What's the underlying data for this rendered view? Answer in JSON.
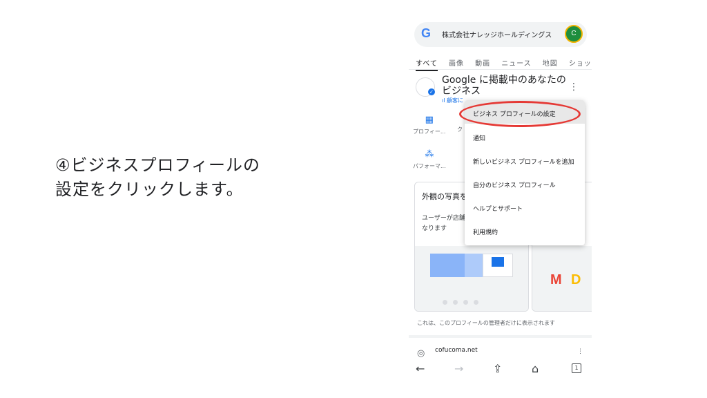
{
  "instruction": {
    "line1": "④ビジネスプロフィールの",
    "line2": "設定をクリックします。"
  },
  "phone": {
    "search": {
      "logo": "G",
      "query": "株式会社ナレッジホールディングス",
      "avatar": "C"
    },
    "tabs": [
      "すべて",
      "画像",
      "動画",
      "ニュース",
      "地図",
      "ショッピ"
    ],
    "business": {
      "title": "Google に掲載中のあなたのビジネス",
      "stats_link": "顧客に",
      "more_icon": "more-vert-icon"
    },
    "actions": [
      {
        "icon": "storefront-icon",
        "label": "プロフィー..."
      },
      {
        "icon": "product-icon",
        "label": "ク"
      },
      {
        "icon": "performance-icon",
        "label": "パフォーマ..."
      }
    ],
    "cards": [
      {
        "title": "外観の写真を",
        "desc": "ユーザーが店舗 なります"
      },
      {
        "title": "",
        "desc": ""
      }
    ],
    "footer_note": "これは、このプロフィールの管理者だけに表示されます",
    "site": {
      "name": "cofucoma.net"
    },
    "bottom_nav": {
      "tab_count": "1"
    }
  },
  "menu": {
    "items": [
      "ビジネス プロフィールの設定",
      "通知",
      "新しいビジネス プロフィールを追加",
      "自分のビジネス プロフィール",
      "ヘルプとサポート",
      "利用規約"
    ]
  },
  "colors": {
    "highlight_ring": "#e53935",
    "accent": "#1a73e8"
  }
}
